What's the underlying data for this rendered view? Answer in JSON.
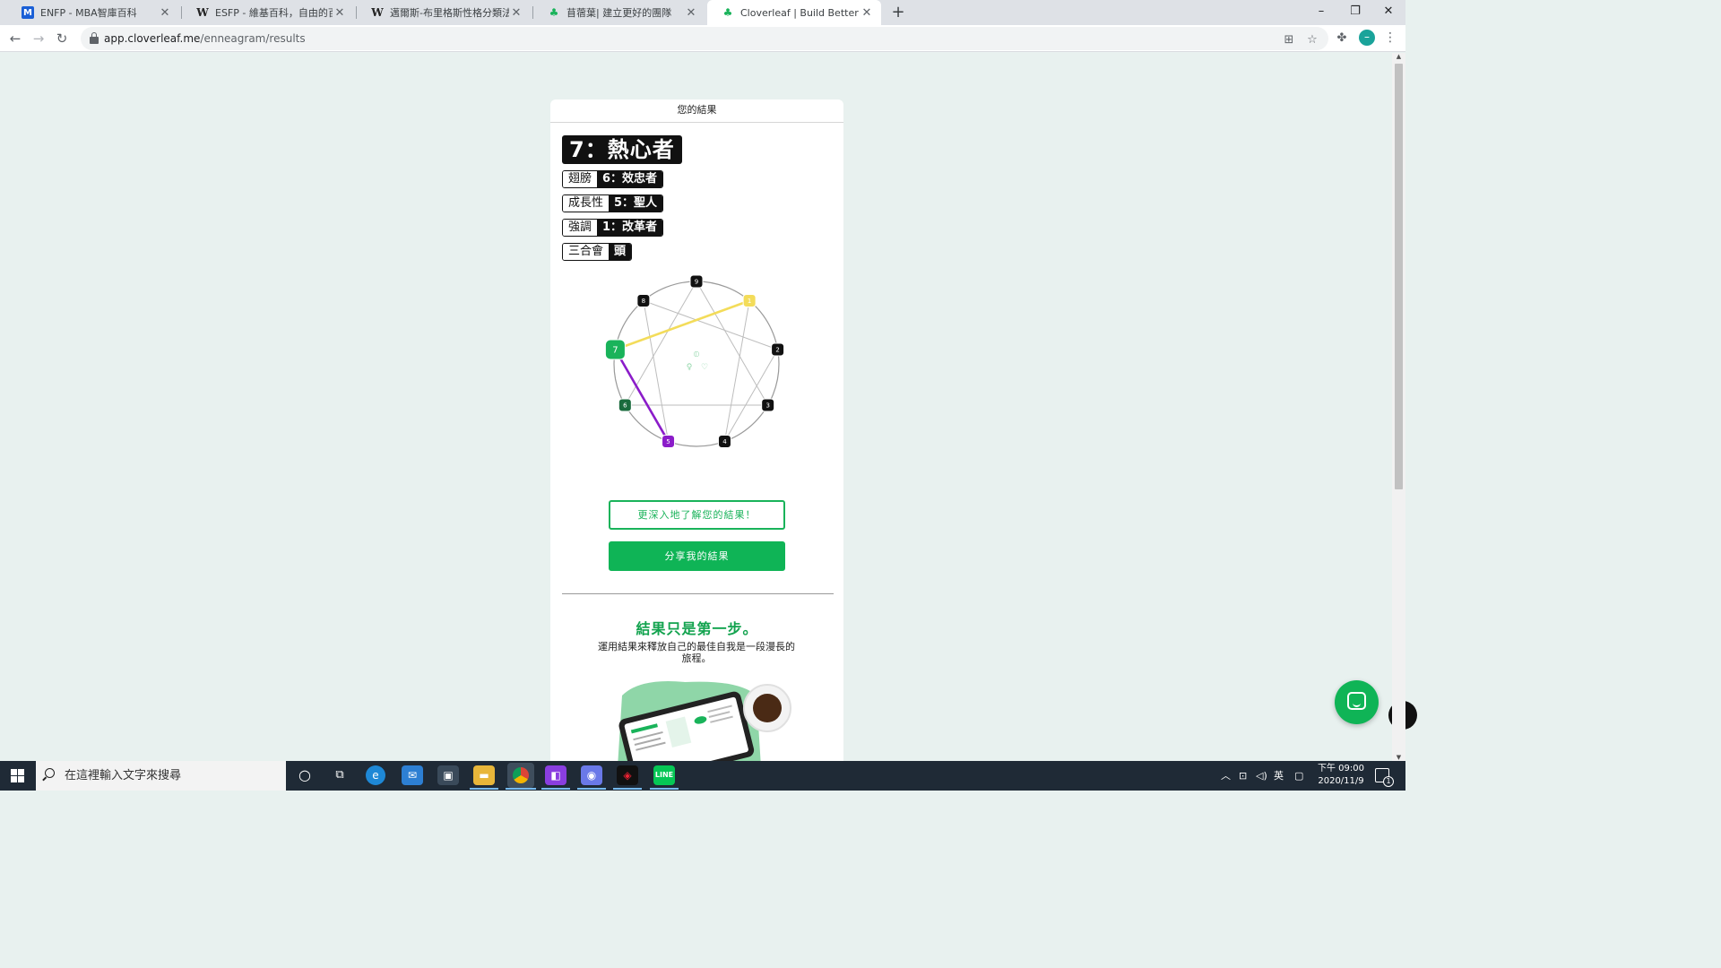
{
  "browser": {
    "tabs": [
      {
        "favicon": "M",
        "label": "ENFP - MBA智庫百科",
        "active": false
      },
      {
        "favicon": "W",
        "label": "ESFP - 維基百科，自由的百科全書",
        "active": false
      },
      {
        "favicon": "W",
        "label": "邁爾斯-布里格斯性格分類法 - 維基",
        "active": false
      },
      {
        "favicon": "leaf",
        "label": "苜蓿葉| 建立更好的團隊",
        "active": false
      },
      {
        "favicon": "leaf",
        "label": "Cloverleaf | Build Better Teams",
        "active": true
      }
    ],
    "new_tab": "+",
    "window_controls": {
      "minimize": "–",
      "restore": "❐",
      "close": "✕"
    },
    "url_host": "app.cloverleaf.me",
    "url_path": "/enneagram/results",
    "profile_initial": "–"
  },
  "page": {
    "card_title": "您的結果",
    "main_type": "7：熱心者",
    "details": [
      {
        "label": "翅膀",
        "value": "6：效忠者"
      },
      {
        "label": "成長性",
        "value": "5：聖人"
      },
      {
        "label": "強調",
        "value": "1：改革者"
      },
      {
        "label": "三合會",
        "value": "頭"
      }
    ],
    "enneagram": {
      "points": [
        "9",
        "1",
        "2",
        "3",
        "4",
        "5",
        "6",
        "7",
        "8"
      ],
      "highlight": {
        "main": "7",
        "wing": "6",
        "growth": "5",
        "stress": "1"
      },
      "center_icons": [
        "♀",
        "⦶",
        "♡"
      ],
      "colors": {
        "main": "#19b35a",
        "wing": "#1a6b3d",
        "growth": "#8b1cc9",
        "stress": "#f3dc5a",
        "default": "#111111"
      }
    },
    "learn_more_button": "更深入地了解您的結果！",
    "share_button": "分享我的結果",
    "step_title": "結果只是第一步。",
    "step_description": "運用結果來釋放自己的最佳自我是一段漫長的旅程。"
  },
  "taskbar": {
    "search_placeholder": "在這裡輸入文字來搜尋",
    "tray_ime": "英",
    "clock_time": "下午 09:00",
    "clock_date": "2020/11/9",
    "notifications": "1"
  }
}
